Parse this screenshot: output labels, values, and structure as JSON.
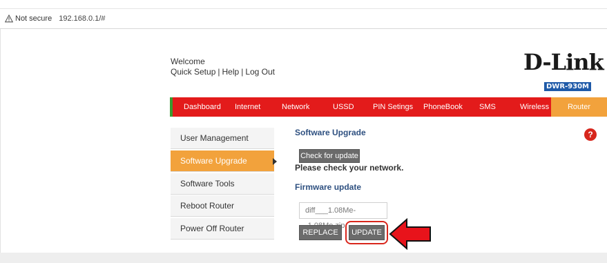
{
  "browser": {
    "security_label": "Not secure",
    "url": "192.168.0.1/#"
  },
  "header": {
    "welcome": "Welcome",
    "links": [
      "Quick Setup",
      "Help",
      "Log Out"
    ],
    "separator": "|",
    "logo_text": "D-Link",
    "model": "DWR-930M"
  },
  "nav": {
    "items": [
      "Dashboard",
      "Internet",
      "Network",
      "USSD",
      "PIN Setings",
      "PhoneBook",
      "SMS",
      "Wireless",
      "Router"
    ],
    "active": "Router"
  },
  "sidebar": {
    "items": [
      "User Management",
      "Software Upgrade",
      "Software Tools",
      "Reboot Router",
      "Power Off Router"
    ],
    "active": "Software Upgrade"
  },
  "main": {
    "software_upgrade": {
      "title": "Software Upgrade",
      "check_button": "Check for update",
      "message": "Please check your network."
    },
    "firmware_update": {
      "title": "Firmware update",
      "file_value": "diff___1.08Me--1.08Me.zip",
      "replace_button": "REPLACE",
      "update_button": "UPDATE"
    },
    "help_icon": "?"
  },
  "colors": {
    "nav_red": "#e31b1b",
    "active_orange": "#f2a23c",
    "accent_green": "#3a9a2f",
    "title_blue": "#2e5080",
    "model_badge": "#1f5aa8",
    "highlight_red": "#d9261c"
  },
  "icons": {
    "security": "warning-triangle-icon",
    "help": "question-circle-icon",
    "annotation": "red-arrow-icon"
  }
}
